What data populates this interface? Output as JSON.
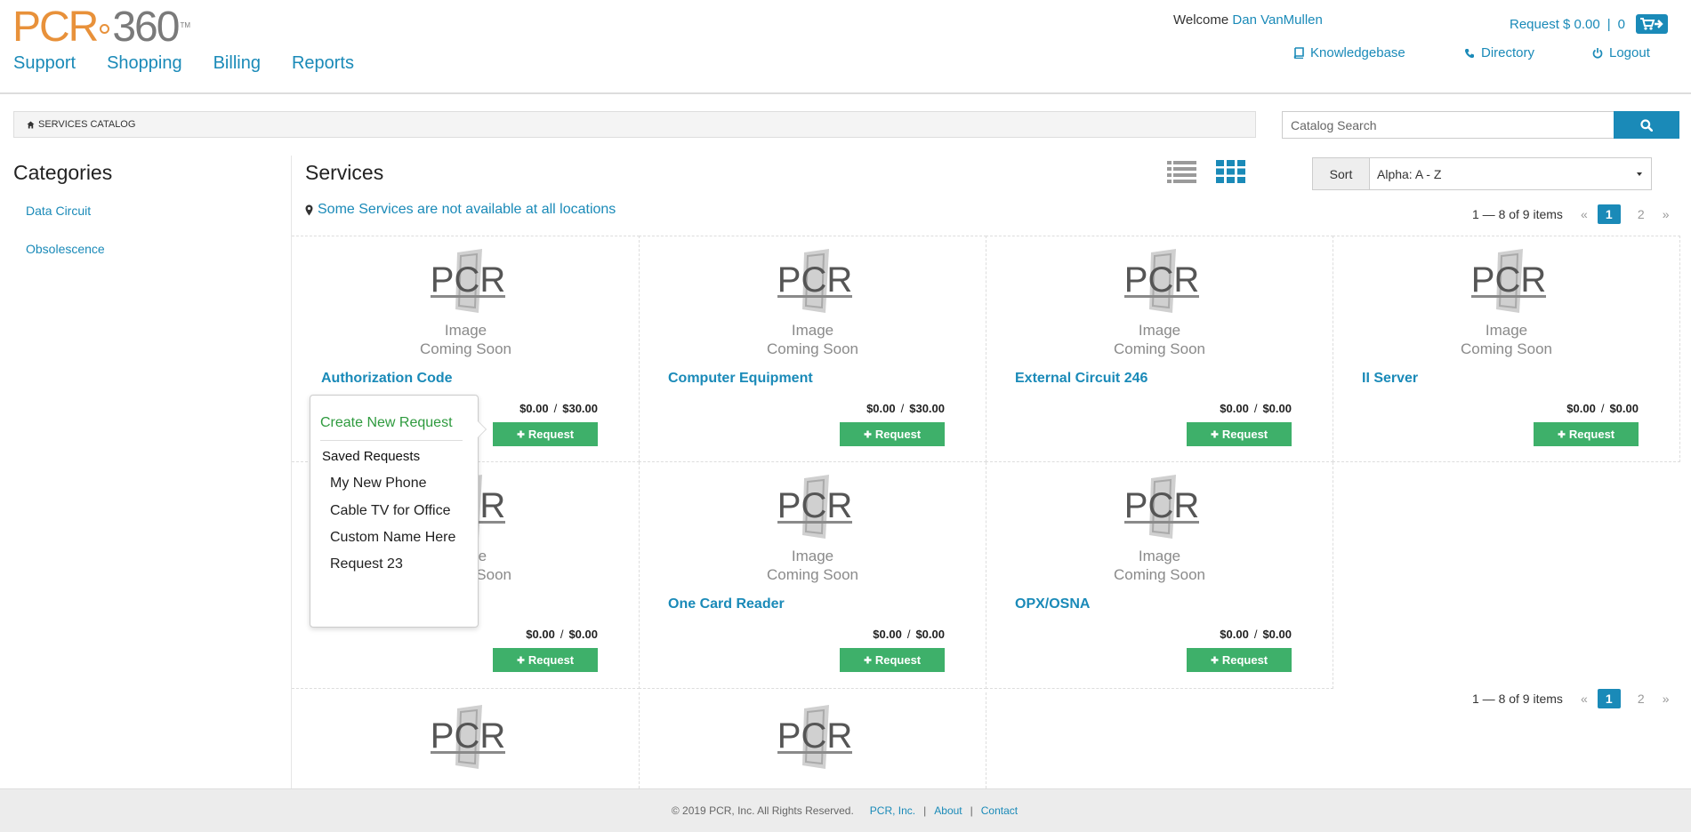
{
  "header": {
    "logo": {
      "pcr": "PCR",
      "num": "360",
      "tm": "TM"
    },
    "nav": [
      "Support",
      "Shopping",
      "Billing",
      "Reports"
    ],
    "welcome_label": "Welcome",
    "user_name": "Dan VanMullen",
    "cart": {
      "request_label": "Request $ 0.00",
      "separator": "|",
      "count": "0"
    },
    "links": {
      "knowledgebase": "Knowledgebase",
      "directory": "Directory",
      "logout": "Logout"
    }
  },
  "breadcrumb": {
    "label": "SERVICES CATALOG"
  },
  "search": {
    "placeholder": "Catalog Search"
  },
  "sidebar": {
    "title": "Categories",
    "items": [
      "Data Circuit",
      "Obsolescence"
    ]
  },
  "services": {
    "title": "Services",
    "notice": "Some Services are not available at all locations",
    "sort_label": "Sort",
    "sort_value": "Alpha: A - Z",
    "pagination": {
      "items_text": "1 — 8 of 9 items",
      "prev": "«",
      "next": "»",
      "pages": [
        "1",
        "2"
      ],
      "current": "1"
    },
    "image_placeholder": {
      "line1": "Image",
      "line2": "Coming Soon"
    },
    "request_label": "Request",
    "cards": [
      {
        "name": "Authorization Code",
        "price_min": "$0.00",
        "price_max": "$30.00"
      },
      {
        "name": "Computer Equipment",
        "price_min": "$0.00",
        "price_max": "$30.00"
      },
      {
        "name": "External Circuit 246",
        "price_min": "$0.00",
        "price_max": "$0.00"
      },
      {
        "name": "II Server",
        "price_min": "$0.00",
        "price_max": "$0.00"
      },
      {
        "name": "",
        "price_min": "$0.00",
        "price_max": "$0.00"
      },
      {
        "name": "One Card Reader",
        "price_min": "$0.00",
        "price_max": "$0.00"
      },
      {
        "name": "OPX/OSNA",
        "price_min": "$0.00",
        "price_max": "$0.00"
      }
    ]
  },
  "popover": {
    "create": "Create New Request",
    "saved_title": "Saved Requests",
    "saved_items": [
      "My New Phone",
      "Cable TV for Office",
      "Custom Name Here",
      "Request 23"
    ]
  },
  "footer": {
    "copyright": "©  2019  PCR, Inc.  All Rights Reserved.",
    "links": [
      "PCR, Inc.",
      "About",
      "Contact"
    ],
    "separator": "|"
  },
  "colors": {
    "accent": "#1a8ab8",
    "brand_orange": "#e8913a",
    "request_green": "#3eb06a",
    "create_green": "#2e9a3e"
  }
}
